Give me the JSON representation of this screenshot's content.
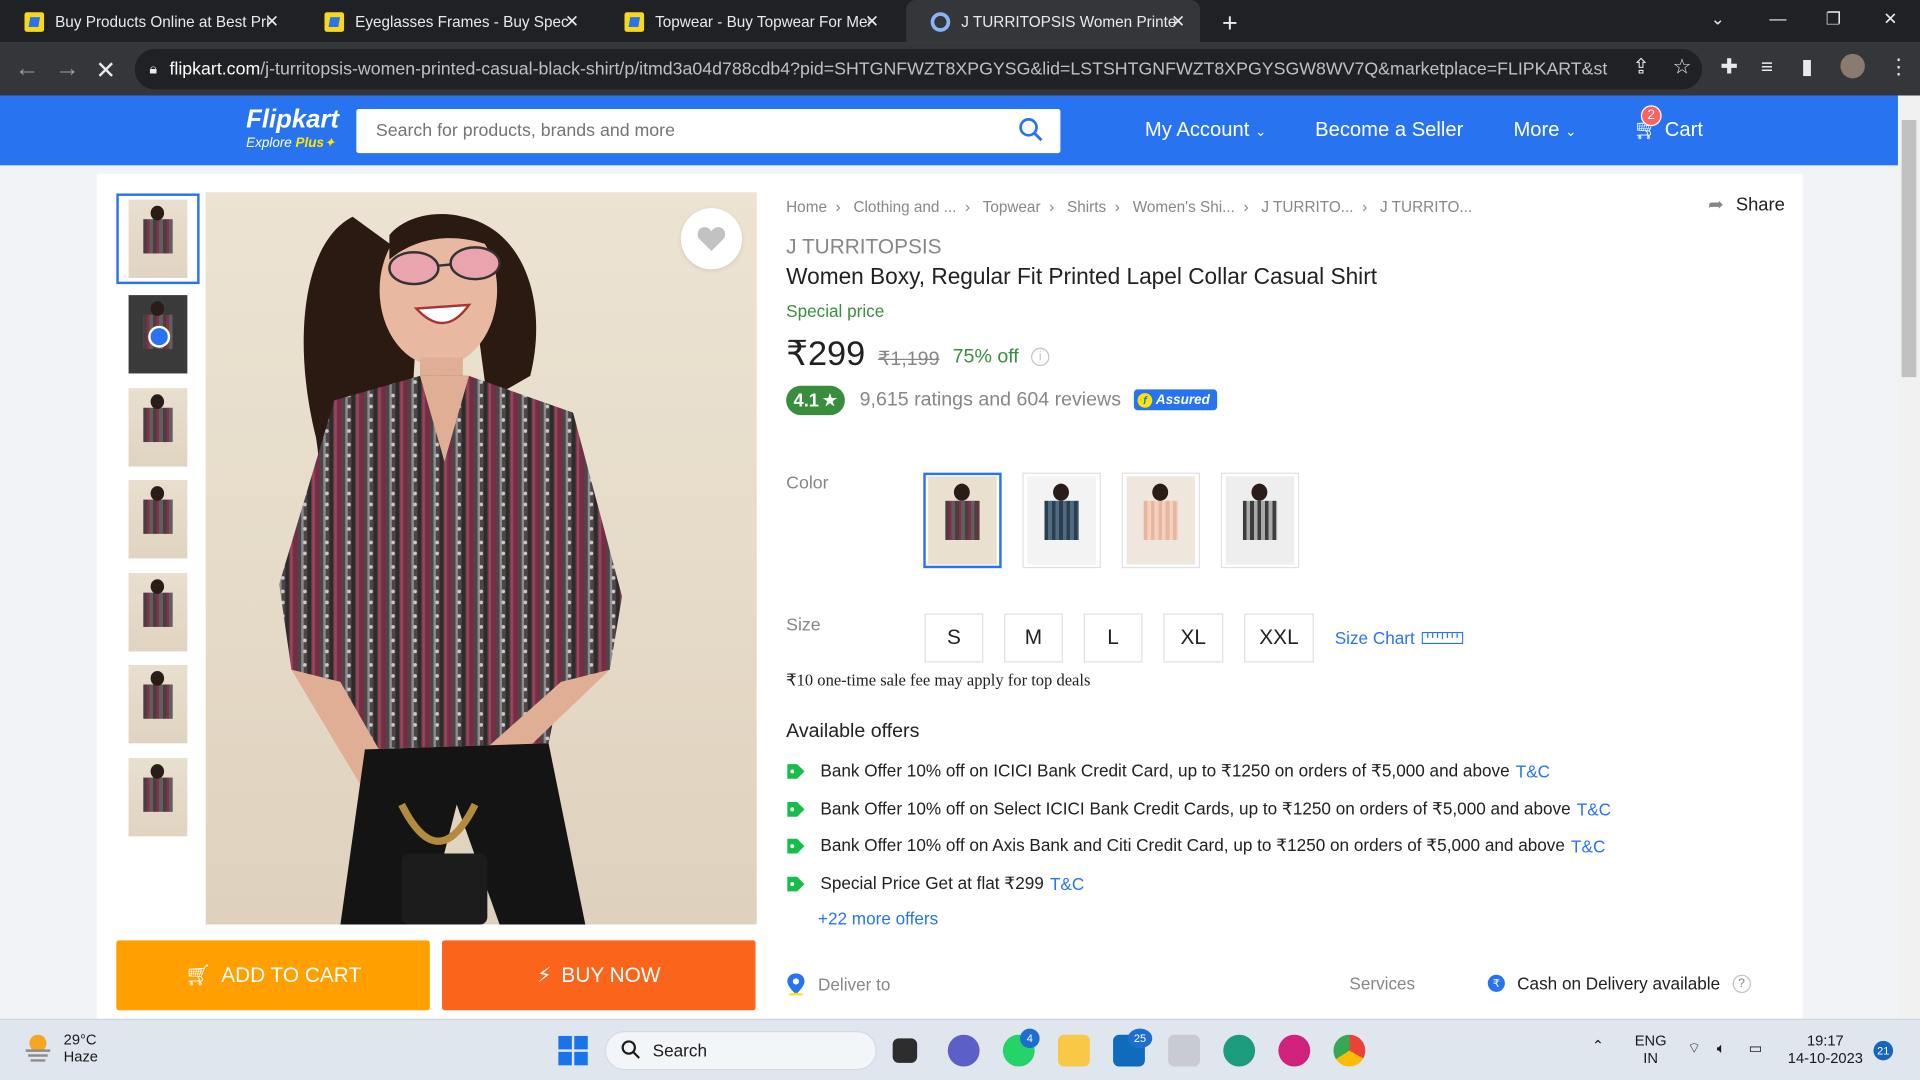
{
  "browser": {
    "tabs": [
      {
        "title": "Buy Products Online at Best Pric"
      },
      {
        "title": "Eyeglasses Frames - Buy Spectac"
      },
      {
        "title": "Topwear - Buy Topwear For Men"
      },
      {
        "title": "J TURRITOPSIS Women Printed C"
      }
    ],
    "url_host": "flipkart.com",
    "url_path": "/j-turritopsis-women-printed-casual-black-shirt/p/itmd3a04d788cdb4?pid=SHTGNFWZT8XPGYSG&lid=LSTSHTGNFWZT8XPGYSGW8WV7Q&marketplace=FLIPKART&store=..."
  },
  "header": {
    "logo": "Flipkart",
    "logo_sub": "Explore",
    "logo_plus": "Plus",
    "search_placeholder": "Search for products, brands and more",
    "my_account": "My Account",
    "become_seller": "Become a Seller",
    "more": "More",
    "cart": "Cart",
    "cart_count": "2"
  },
  "breadcrumbs": [
    "Home",
    "Clothing and ...",
    "Topwear",
    "Shirts",
    "Women's Shi...",
    "J TURRITO...",
    "J TURRITO..."
  ],
  "share": "Share",
  "product": {
    "brand": "J TURRITOPSIS",
    "title": "Women Boxy, Regular Fit Printed Lapel Collar Casual Shirt",
    "special": "Special price",
    "price": "₹299",
    "mrp": "₹1,199",
    "discount": "75% off",
    "rating": "4.1",
    "reviews": "9,615 ratings and 604 reviews",
    "assured": "Assured"
  },
  "color_label": "Color",
  "size_label": "Size",
  "sizes": [
    "S",
    "M",
    "L",
    "XL",
    "XXL"
  ],
  "size_chart": "Size Chart",
  "sale_fee": "₹10 one-time sale fee may apply for top deals",
  "offers": {
    "heading": "Available offers",
    "items": [
      {
        "text": "Bank Offer 10% off on ICICI Bank Credit Card, up to ₹1250 on orders of ₹5,000 and above",
        "tc": "T&C"
      },
      {
        "text": "Bank Offer 10% off on Select ICICI Bank Credit Cards, up to ₹1250 on orders of ₹5,000 and above",
        "tc": "T&C"
      },
      {
        "text": "Bank Offer 10% off on Axis Bank and Citi Credit Card, up to ₹1250 on orders of ₹5,000 and above",
        "tc": "T&C"
      },
      {
        "text": "Special Price Get at flat ₹299",
        "tc": "T&C"
      }
    ],
    "more": "+22 more offers"
  },
  "deliver_to": "Deliver to",
  "services": "Services",
  "cod": "Cash on Delivery available",
  "buttons": {
    "add_to_cart": "ADD TO CART",
    "buy_now": "BUY NOW"
  },
  "taskbar": {
    "temp": "29°C",
    "weather": "Haze",
    "search": "Search",
    "whatsapp_badge": "4",
    "mail_badge": "25",
    "lang1": "ENG",
    "lang2": "IN",
    "time": "19:17",
    "date": "14-10-2023",
    "notif": "21"
  },
  "colors": {
    "flipkart_blue": "#2874f0",
    "buy_orange": "#fb641b",
    "cart_yellow": "#ff9f00",
    "green": "#388e3c"
  }
}
